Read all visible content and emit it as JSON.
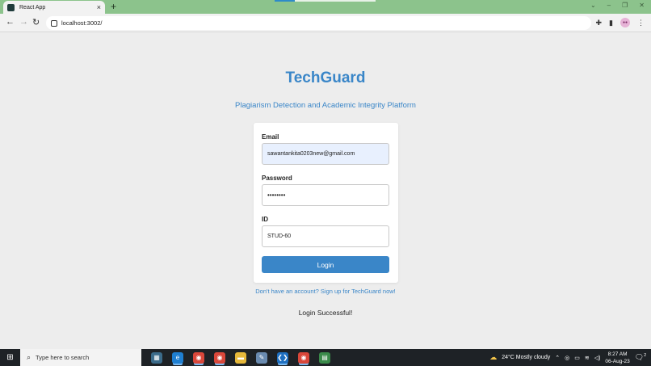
{
  "browser": {
    "tab_title": "React App",
    "tab_close": "×",
    "new_tab": "+",
    "url": "localhost:3002/",
    "window_controls": [
      "⌄",
      "–",
      "❐",
      "✕"
    ]
  },
  "page": {
    "title": "TechGuard",
    "subtitle": "Plagiarism Detection and Academic Integrity Platform",
    "form": {
      "email_label": "Email",
      "email_value": "sawantankita0203new@gmail.com",
      "password_label": "Password",
      "password_value": "••••••••",
      "id_label": "ID",
      "id_value": "STUD-60",
      "login_button": "Login"
    },
    "signup_link": "Don't have an account? Sign up for TechGuard now!",
    "status_message": "Login Successful!"
  },
  "taskbar": {
    "search_placeholder": "Type here to search",
    "weather": "24°C  Mostly cloudy",
    "time": "8:27 AM",
    "date": "06-Aug-23",
    "notification_count": "2"
  },
  "colors": {
    "accent": "#3a86c8",
    "tabbar": "#8cc38c",
    "autofill": "#e8f0fe"
  }
}
